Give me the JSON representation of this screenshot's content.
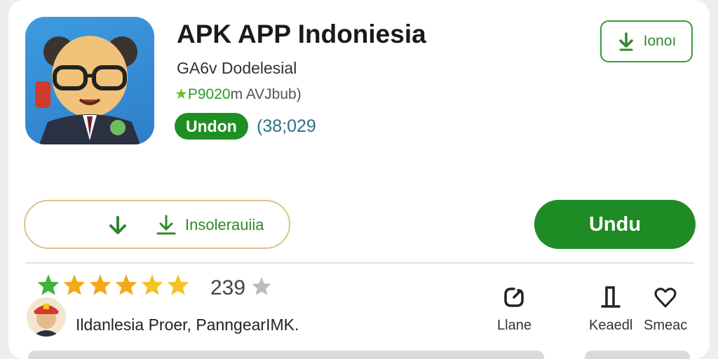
{
  "app": {
    "title": "APK APP Indoniesia",
    "subtitle": "GA6v Dodelesial",
    "rating_text": "P9020",
    "rating_suffix": "m AVJbub)",
    "badge": "Undon",
    "count_paren": "(38;029"
  },
  "top_button": {
    "label": "Ionoı"
  },
  "install_button": {
    "label": "Insolerauiia"
  },
  "primary_button": {
    "label": "Undu"
  },
  "reviews": {
    "stars": 5,
    "count": "239"
  },
  "publisher": {
    "name": "Ildanlesia Proer, PanngearIMK."
  },
  "actions": [
    {
      "label": "Llane",
      "icon": "share-icon"
    },
    {
      "label": "Keaedl",
      "icon": "bookmark-icon"
    },
    {
      "label": "Smeac",
      "icon": "heart-icon"
    }
  ],
  "colors": {
    "accent": "#1e8b24",
    "star": "#f2a818",
    "icon_bg": "#3e9be0"
  }
}
